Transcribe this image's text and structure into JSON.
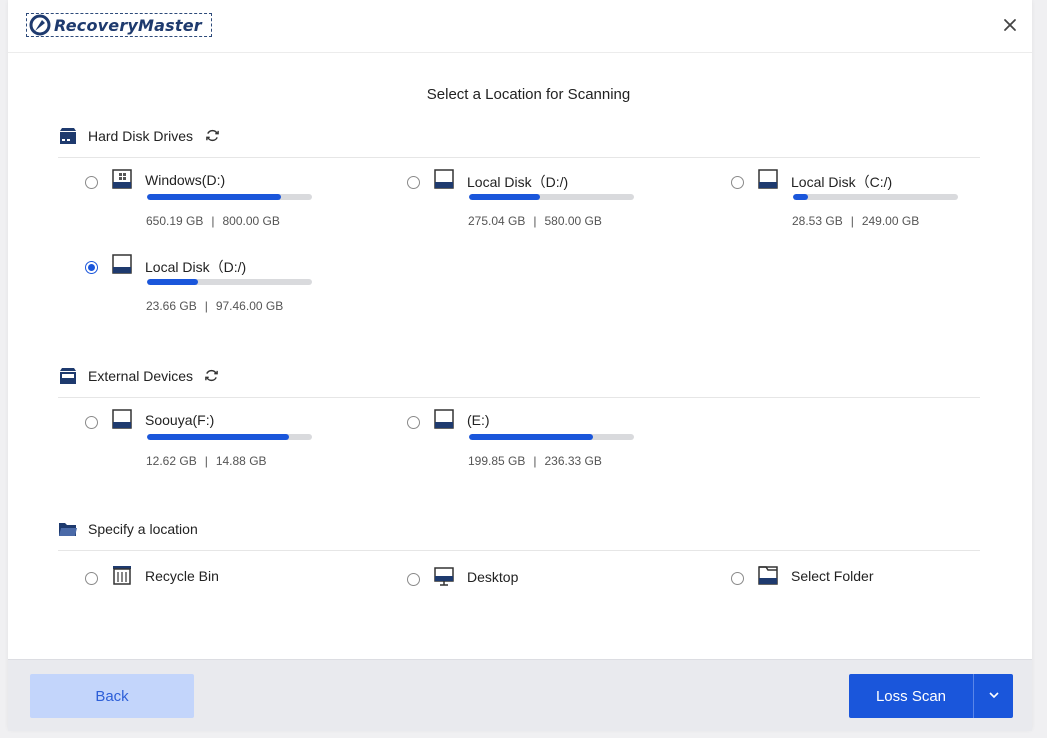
{
  "app": {
    "logo_text": "RecoveryMaster"
  },
  "page": {
    "title": "Select a Location for Scanning"
  },
  "sections": {
    "hard_disk": {
      "title": "Hard Disk Drives",
      "drives": [
        {
          "name": "Windows(D:)",
          "used": "650.19 GB",
          "total": "800.00 GB",
          "usage_fraction": 0.81,
          "selected": false,
          "icon": "windows-drive-icon"
        },
        {
          "name": "Local Disk（D:/)",
          "used": "275.04 GB",
          "total": "580.00 GB",
          "usage_fraction": 0.43,
          "selected": false,
          "icon": "disk-drive-icon"
        },
        {
          "name": "Local Disk（C:/)",
          "used": "28.53 GB",
          "total": "249.00 GB",
          "usage_fraction": 0.09,
          "selected": false,
          "icon": "disk-drive-icon"
        },
        {
          "name": "Local Disk（D:/)",
          "used": "23.66 GB",
          "total": "97.46.00 GB",
          "usage_fraction": 0.31,
          "selected": true,
          "icon": "disk-drive-icon"
        }
      ]
    },
    "external": {
      "title": "External Devices",
      "drives": [
        {
          "name": "Soouya(F:)",
          "used": "12.62 GB",
          "total": "14.88 GB",
          "usage_fraction": 0.86,
          "selected": false,
          "icon": "disk-drive-icon"
        },
        {
          "name": "(E:)",
          "used": "199.85 GB",
          "total": "236.33 GB",
          "usage_fraction": 0.75,
          "selected": false,
          "icon": "disk-drive-icon"
        }
      ]
    },
    "location": {
      "title": "Specify a location",
      "items": [
        {
          "name": "Recycle Bin",
          "icon": "recycle-bin-icon"
        },
        {
          "name": "Desktop",
          "icon": "desktop-icon"
        },
        {
          "name": "Select Folder",
          "icon": "folder-icon"
        }
      ]
    }
  },
  "footer": {
    "back_label": "Back",
    "scan_label": "Loss Scan"
  },
  "colors": {
    "accent": "#1a56db",
    "back_bg": "#c3d5fb",
    "bar_track": "#d9dadd",
    "footer_bg": "#e9eaee",
    "icon_navy": "#1e3a6e"
  }
}
